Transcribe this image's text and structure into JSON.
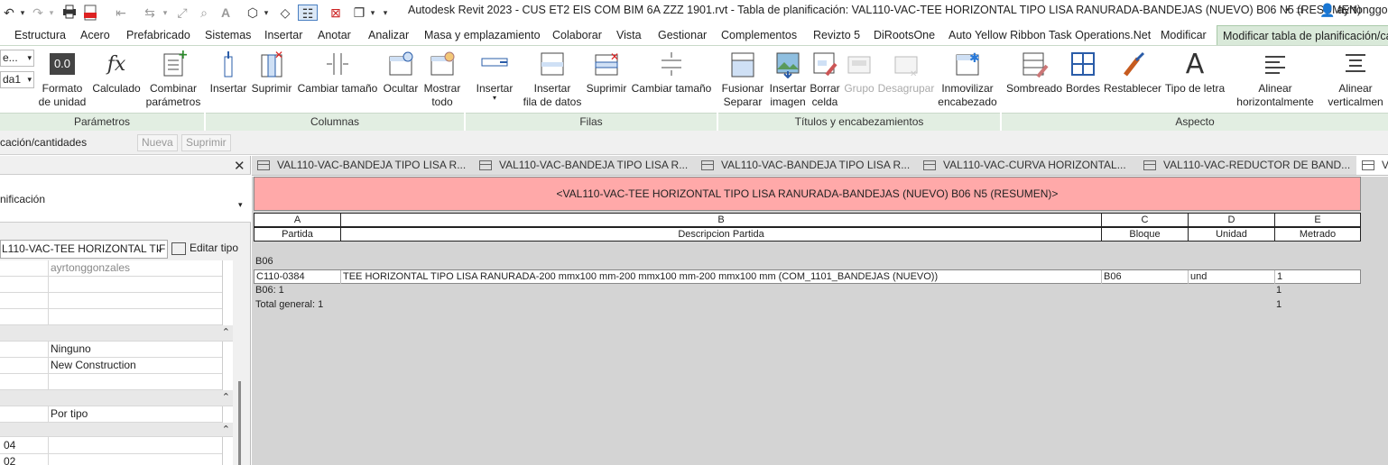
{
  "titlebar": {
    "title": "Autodesk Revit 2023 - CUS ET2 EIS COM BIM 6A ZZZ 1901.rvt - Tabla de planificación: VAL110-VAC-TEE HORIZONTAL TIPO LISA RANURADA-BANDEJAS (NUEVO) B06 N5 (RESUMEN)",
    "user": "ayrtonggo"
  },
  "tabs": [
    {
      "label": "Estructura"
    },
    {
      "label": "Acero"
    },
    {
      "label": "Prefabricado"
    },
    {
      "label": "Sistemas"
    },
    {
      "label": "Insertar"
    },
    {
      "label": "Anotar"
    },
    {
      "label": "Analizar"
    },
    {
      "label": "Masa y emplazamiento"
    },
    {
      "label": "Colaborar"
    },
    {
      "label": "Vista"
    },
    {
      "label": "Gestionar"
    },
    {
      "label": "Complementos"
    },
    {
      "label": "Revizto 5"
    },
    {
      "label": "DiRootsOne"
    },
    {
      "label": "Auto Yellow Ribbon Task Operations.Net"
    },
    {
      "label": "Modificar"
    },
    {
      "label": "Modificar tabla de planificación/ca"
    }
  ],
  "ribbon": {
    "left_dropdowns": [
      "e...",
      "da1"
    ],
    "buttons": {
      "formato": "Formato\nde unidad",
      "calculado": "Calculado",
      "combinar": "Combinar\nparámetros",
      "col_insertar": "Insertar",
      "col_suprimir": "Suprimir",
      "col_cambiar": "Cambiar tamaño",
      "ocultar": "Ocultar",
      "mostrar": "Mostrar\ntodo",
      "fil_insertar": "Insertar",
      "fil_insertar_datos": "Insertar\nfila de datos",
      "fil_suprimir": "Suprimir",
      "fil_cambiar": "Cambiar tamaño",
      "fusionar": "Fusionar\nSeparar",
      "insertar_imagen": "Insertar\nimagen",
      "borrar_celda": "Borrar\ncelda",
      "grupo": "Grupo",
      "desagrupar": "Desagrupar",
      "inmovilizar": "Inmovilizar\nencabezado",
      "sombreado": "Sombreado",
      "bordes": "Bordes",
      "restablecer": "Restablecer",
      "tipo_letra": "Tipo de letra",
      "alinear_h": "Alinear\nhorizontalmente",
      "alinear_v": "Alinear\nverticalmen"
    },
    "panels": {
      "parametros": "Parámetros",
      "columnas": "Columnas",
      "filas": "Filas",
      "titulos": "Títulos y encabezamientos",
      "aspecto": "Aspecto"
    },
    "zero_icon": "0.0"
  },
  "optionsbar": {
    "context": "cación/cantidades",
    "nueva": "Nueva",
    "suprimir": "Suprimir"
  },
  "properties": {
    "type_label": "nificación",
    "type_selector": "L110-VAC-TEE HORIZONTAL TIF",
    "edit_type": "Editar tipo",
    "rows": {
      "owner": "ayrtonggonzales",
      "ninguno": "Ninguno",
      "phase": "New Construction",
      "por_tipo": "Por tipo",
      "left_04": "04",
      "left_02": "02"
    }
  },
  "doc_tabs": [
    {
      "label": "VAL110-VAC-BANDEJA TIPO LISA R..."
    },
    {
      "label": "VAL110-VAC-BANDEJA TIPO LISA R..."
    },
    {
      "label": "VAL110-VAC-BANDEJA TIPO LISA R..."
    },
    {
      "label": "VAL110-VAC-CURVA HORIZONTAL..."
    },
    {
      "label": "VAL110-VAC-REDUCTOR DE BAND..."
    },
    {
      "label": "V"
    }
  ],
  "schedule": {
    "title": "<VAL110-VAC-TEE HORIZONTAL TIPO LISA RANURADA-BANDEJAS (NUEVO) B06 N5 (RESUMEN)>",
    "letters": [
      "A",
      "B",
      "C",
      "D",
      "E"
    ],
    "headers": [
      "Partida",
      "Descripcion Partida",
      "Bloque",
      "Unidad",
      "Metrado"
    ],
    "group_label": "B06",
    "rows": [
      [
        "C110-0384",
        "TEE HORIZONTAL TIPO LISA RANURADA-200 mmx100 mm-200 mmx100 mm-200 mmx100 mm (COM_1101_BANDEJAS (NUEVO))",
        "B06",
        "und",
        "1"
      ]
    ],
    "subtotal_label": "B06: 1",
    "subtotal_value": "1",
    "total_label": "Total general: 1",
    "total_value": "1"
  },
  "colors": {
    "title_fill": "#ffa9a9",
    "ribbon_panel": "#e2eee2",
    "sheet_bg": "#d4d4d4"
  }
}
